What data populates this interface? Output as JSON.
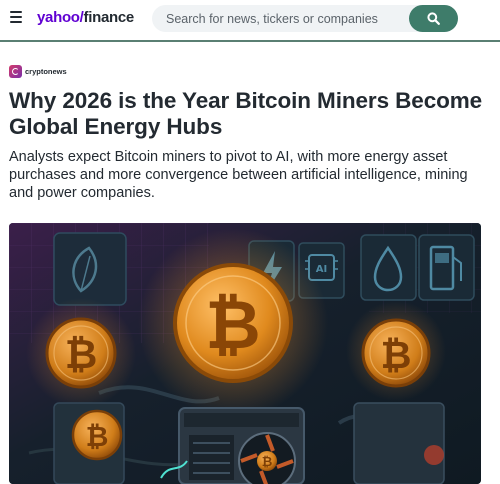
{
  "header": {
    "logo_yahoo": "yahoo/",
    "logo_finance": "finance",
    "search_placeholder": "Search for news, tickers or companies",
    "menu_icon": "hamburger-menu-icon",
    "search_icon": "magnifier-icon",
    "accent_color": "#3e7c6a",
    "brand_color": "#6001d2"
  },
  "article": {
    "source": "cryptonews",
    "title": "Why 2026 is the Year Bitcoin Miners Become Global Energy Hubs",
    "subtitle": "Analysts expect Bitcoin miners to pivot to AI, with more energy asset purchases and more convergence between artificial intelligence, mining and power companies.",
    "hero_icons": [
      "leaf-icon",
      "lightning-icon",
      "ai-chip-icon",
      "water-drop-icon",
      "fuel-pump-icon",
      "bitcoin-coin-icon",
      "mining-rig-icon"
    ]
  }
}
